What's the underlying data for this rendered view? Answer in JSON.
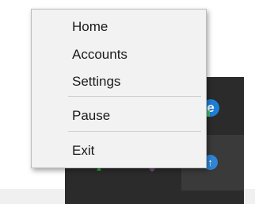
{
  "context_menu": {
    "items": [
      {
        "label": "Home"
      },
      {
        "label": "Accounts"
      },
      {
        "label": "Settings"
      },
      {
        "label": "Pause"
      },
      {
        "label": "Exit"
      }
    ]
  },
  "tray": {
    "icons": [
      {
        "name": "edge-icon",
        "glyph": "e",
        "color": "#1e7fd6"
      },
      {
        "name": "update-icon",
        "glyph": "↑",
        "color": "#2f86d8"
      },
      {
        "name": "green-app-icon",
        "glyph": "▲",
        "color": "#28b040"
      },
      {
        "name": "purple-app-icon",
        "glyph": "❈",
        "color": "#d070e0"
      }
    ]
  },
  "colors": {
    "menu_background": "#f2f2f2",
    "tray_background": "#2b2b2b"
  }
}
